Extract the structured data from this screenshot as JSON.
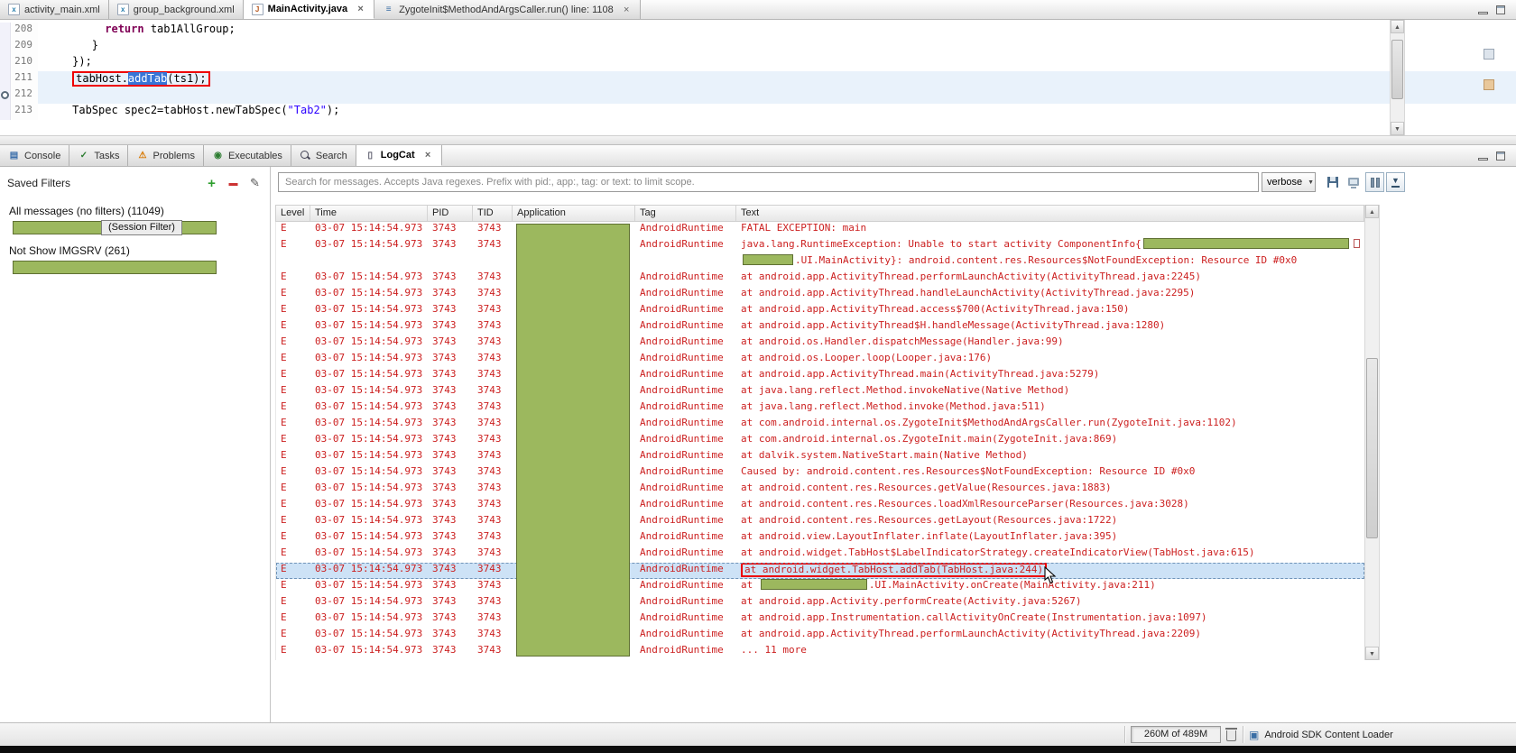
{
  "colors": {
    "error_red": "#cc2020",
    "redaction_green": "#9cb85e",
    "redaction_border": "#5f7033",
    "keyword": "#7f0055",
    "string_blue": "#2a00ff",
    "selection_row": "#cde2f6",
    "marker_red": "#ee0000"
  },
  "icons": {
    "xml-file": {
      "glyph": "x",
      "color": "#2a7fae"
    },
    "java-file": {
      "glyph": "J",
      "color": "#b5551d"
    },
    "stack-frame": {
      "glyph": "≡",
      "color": "#3a6ea5"
    },
    "console": {
      "glyph": "▤",
      "color": "#3b6eaa"
    },
    "tasks": {
      "glyph": "✓",
      "color": "#2e7d32"
    },
    "problems": {
      "glyph": "⚠",
      "color": "#d87800"
    },
    "executables": {
      "glyph": "◉",
      "color": "#2e7d32"
    },
    "search": {
      "glyph": "",
      "color": "#445"
    },
    "logcat": {
      "glyph": "▯",
      "color": "#556"
    }
  },
  "editor": {
    "tabs": [
      {
        "label": "activity_main.xml",
        "icon": "xml-file",
        "active": false,
        "closable": false
      },
      {
        "label": "group_background.xml",
        "icon": "xml-file",
        "active": false,
        "closable": false
      },
      {
        "label": "MainActivity.java",
        "icon": "java-file",
        "active": true,
        "closable": true
      },
      {
        "label": "ZygoteInit$MethodAndArgsCaller.run() line: 1108",
        "icon": "stack-frame",
        "active": false,
        "closable": true
      }
    ],
    "code_lines": [
      {
        "num": "208",
        "indent": "          ",
        "segments": [
          {
            "t": "return",
            "c": "kw"
          },
          {
            "t": " tab1AllGroup;"
          }
        ]
      },
      {
        "num": "209",
        "indent": "        ",
        "segments": [
          {
            "t": "}"
          }
        ]
      },
      {
        "num": "210",
        "indent": "     ",
        "segments": [
          {
            "t": "});"
          }
        ]
      },
      {
        "num": "211",
        "indent": "     ",
        "boxed": true,
        "highlight": true,
        "segments": [
          {
            "t": "tabHost."
          },
          {
            "t": "addTab",
            "c": "sel"
          },
          {
            "t": "(ts1);"
          }
        ]
      },
      {
        "num": "212",
        "indent": "",
        "breakpoint": true,
        "highlight": true,
        "segments": []
      },
      {
        "num": "213",
        "indent": "     ",
        "segments": [
          {
            "t": "TabSpec spec2=tabHost.newTabSpec("
          },
          {
            "t": "\"Tab2\"",
            "c": "str"
          },
          {
            "t": ");"
          }
        ]
      }
    ]
  },
  "panel": {
    "tabs": [
      {
        "label": "Console",
        "icon": "console",
        "active": false,
        "closable": false
      },
      {
        "label": "Tasks",
        "icon": "tasks",
        "active": false,
        "closable": false
      },
      {
        "label": "Problems",
        "icon": "problems",
        "active": false,
        "closable": false
      },
      {
        "label": "Executables",
        "icon": "executables",
        "active": false,
        "closable": false
      },
      {
        "label": "Search",
        "icon": "search",
        "active": false,
        "closable": false
      },
      {
        "label": "LogCat",
        "icon": "logcat",
        "active": true,
        "closable": true
      }
    ]
  },
  "logcat": {
    "filters_title": "Saved Filters",
    "filters": [
      {
        "label": "All messages (no filters) (11049)",
        "redaction": true,
        "overlay_label": "(Session Filter)"
      },
      {
        "label": "Not Show IMGSRV (261)",
        "redaction": true
      }
    ],
    "search_placeholder": "Search for messages. Accepts Java regexes. Prefix with pid:, app:, tag: or text: to limit scope.",
    "level_filter": "verbose",
    "columns": [
      "Level",
      "Time",
      "PID",
      "TID",
      "Application",
      "Tag",
      "Text"
    ],
    "rows": [
      {
        "level": "E",
        "time": "03-07 15:14:54.973",
        "pid": "3743",
        "tid": "3743",
        "tag": "AndroidRuntime",
        "parts": [
          {
            "t": "FATAL EXCEPTION: main"
          }
        ]
      },
      {
        "level": "E",
        "time": "03-07 15:14:54.973",
        "pid": "3743",
        "tid": "3743",
        "tag": "AndroidRuntime",
        "parts": [
          {
            "t": "java.lang.RuntimeException: Unable to start activity ComponentInfo{"
          },
          {
            "redact": 228
          },
          {
            "tofu": true
          }
        ]
      },
      {
        "level": "",
        "time": "",
        "pid": "",
        "tid": "",
        "tag": "",
        "parts": [
          {
            "redact": 56
          },
          {
            "t": ".UI.MainActivity}: android.content.res.Resources$NotFoundException: Resource ID #0x0"
          }
        ]
      },
      {
        "level": "E",
        "time": "03-07 15:14:54.973",
        "pid": "3743",
        "tid": "3743",
        "tag": "AndroidRuntime",
        "parts": [
          {
            "t": "at android.app.ActivityThread.performLaunchActivity(ActivityThread.java:2245)"
          }
        ]
      },
      {
        "level": "E",
        "time": "03-07 15:14:54.973",
        "pid": "3743",
        "tid": "3743",
        "tag": "AndroidRuntime",
        "parts": [
          {
            "t": "at android.app.ActivityThread.handleLaunchActivity(ActivityThread.java:2295)"
          }
        ]
      },
      {
        "level": "E",
        "time": "03-07 15:14:54.973",
        "pid": "3743",
        "tid": "3743",
        "tag": "AndroidRuntime",
        "parts": [
          {
            "t": "at android.app.ActivityThread.access$700(ActivityThread.java:150)"
          }
        ]
      },
      {
        "level": "E",
        "time": "03-07 15:14:54.973",
        "pid": "3743",
        "tid": "3743",
        "tag": "AndroidRuntime",
        "parts": [
          {
            "t": "at android.app.ActivityThread$H.handleMessage(ActivityThread.java:1280)"
          }
        ]
      },
      {
        "level": "E",
        "time": "03-07 15:14:54.973",
        "pid": "3743",
        "tid": "3743",
        "tag": "AndroidRuntime",
        "parts": [
          {
            "t": "at android.os.Handler.dispatchMessage(Handler.java:99)"
          }
        ]
      },
      {
        "level": "E",
        "time": "03-07 15:14:54.973",
        "pid": "3743",
        "tid": "3743",
        "tag": "AndroidRuntime",
        "parts": [
          {
            "t": "at android.os.Looper.loop(Looper.java:176)"
          }
        ]
      },
      {
        "level": "E",
        "time": "03-07 15:14:54.973",
        "pid": "3743",
        "tid": "3743",
        "tag": "AndroidRuntime",
        "parts": [
          {
            "t": "at android.app.ActivityThread.main(ActivityThread.java:5279)"
          }
        ]
      },
      {
        "level": "E",
        "time": "03-07 15:14:54.973",
        "pid": "3743",
        "tid": "3743",
        "tag": "AndroidRuntime",
        "parts": [
          {
            "t": "at java.lang.reflect.Method.invokeNative(Native Method)"
          }
        ]
      },
      {
        "level": "E",
        "time": "03-07 15:14:54.973",
        "pid": "3743",
        "tid": "3743",
        "tag": "AndroidRuntime",
        "parts": [
          {
            "t": "at java.lang.reflect.Method.invoke(Method.java:511)"
          }
        ]
      },
      {
        "level": "E",
        "time": "03-07 15:14:54.973",
        "pid": "3743",
        "tid": "3743",
        "tag": "AndroidRuntime",
        "parts": [
          {
            "t": "at com.android.internal.os.ZygoteInit$MethodAndArgsCaller.run(ZygoteInit.java:1102)"
          }
        ]
      },
      {
        "level": "E",
        "time": "03-07 15:14:54.973",
        "pid": "3743",
        "tid": "3743",
        "tag": "AndroidRuntime",
        "parts": [
          {
            "t": "at com.android.internal.os.ZygoteInit.main(ZygoteInit.java:869)"
          }
        ]
      },
      {
        "level": "E",
        "time": "03-07 15:14:54.973",
        "pid": "3743",
        "tid": "3743",
        "tag": "AndroidRuntime",
        "parts": [
          {
            "t": "at dalvik.system.NativeStart.main(Native Method)"
          }
        ]
      },
      {
        "level": "E",
        "time": "03-07 15:14:54.973",
        "pid": "3743",
        "tid": "3743",
        "tag": "AndroidRuntime",
        "parts": [
          {
            "t": "Caused by: android.content.res.Resources$NotFoundException: Resource ID #0x0"
          }
        ]
      },
      {
        "level": "E",
        "time": "03-07 15:14:54.973",
        "pid": "3743",
        "tid": "3743",
        "tag": "AndroidRuntime",
        "parts": [
          {
            "t": "at android.content.res.Resources.getValue(Resources.java:1883)"
          }
        ]
      },
      {
        "level": "E",
        "time": "03-07 15:14:54.973",
        "pid": "3743",
        "tid": "3743",
        "tag": "AndroidRuntime",
        "parts": [
          {
            "t": "at android.content.res.Resources.loadXmlResourceParser(Resources.java:3028)"
          }
        ]
      },
      {
        "level": "E",
        "time": "03-07 15:14:54.973",
        "pid": "3743",
        "tid": "3743",
        "tag": "AndroidRuntime",
        "parts": [
          {
            "t": "at android.content.res.Resources.getLayout(Resources.java:1722)"
          }
        ]
      },
      {
        "level": "E",
        "time": "03-07 15:14:54.973",
        "pid": "3743",
        "tid": "3743",
        "tag": "AndroidRuntime",
        "parts": [
          {
            "t": "at android.view.LayoutInflater.inflate(LayoutInflater.java:395)"
          }
        ]
      },
      {
        "level": "E",
        "time": "03-07 15:14:54.973",
        "pid": "3743",
        "tid": "3743",
        "tag": "AndroidRuntime",
        "parts": [
          {
            "t": "at android.widget.TabHost$LabelIndicatorStrategy.createIndicatorView(TabHost.java:615)"
          }
        ]
      },
      {
        "level": "E",
        "time": "03-07 15:14:54.973",
        "pid": "3743",
        "tid": "3743",
        "tag": "AndroidRuntime",
        "selected": true,
        "redbox": true,
        "parts": [
          {
            "t": "at android.widget.TabHost.addTab(TabHost.java:244)"
          }
        ]
      },
      {
        "level": "E",
        "time": "03-07 15:14:54.973",
        "pid": "3743",
        "tid": "3743",
        "tag": "AndroidRuntime",
        "parts": [
          {
            "t": "at "
          },
          {
            "redact": 118
          },
          {
            "t": ".UI.MainActivity.onCreate(MainActivity.java:211)"
          }
        ]
      },
      {
        "level": "E",
        "time": "03-07 15:14:54.973",
        "pid": "3743",
        "tid": "3743",
        "tag": "AndroidRuntime",
        "parts": [
          {
            "t": "at android.app.Activity.performCreate(Activity.java:5267)"
          }
        ]
      },
      {
        "level": "E",
        "time": "03-07 15:14:54.973",
        "pid": "3743",
        "tid": "3743",
        "tag": "AndroidRuntime",
        "parts": [
          {
            "t": "at android.app.Instrumentation.callActivityOnCreate(Instrumentation.java:1097)"
          }
        ]
      },
      {
        "level": "E",
        "time": "03-07 15:14:54.973",
        "pid": "3743",
        "tid": "3743",
        "tag": "AndroidRuntime",
        "parts": [
          {
            "t": "at android.app.ActivityThread.performLaunchActivity(ActivityThread.java:2209)"
          }
        ]
      },
      {
        "level": "E",
        "time": "03-07 15:14:54.973",
        "pid": "3743",
        "tid": "3743",
        "tag": "AndroidRuntime",
        "parts": [
          {
            "t": "... 11 more"
          }
        ]
      }
    ]
  },
  "status_bar": {
    "memory": "260M of 489M",
    "loader_label": "Android SDK Content Loader"
  }
}
